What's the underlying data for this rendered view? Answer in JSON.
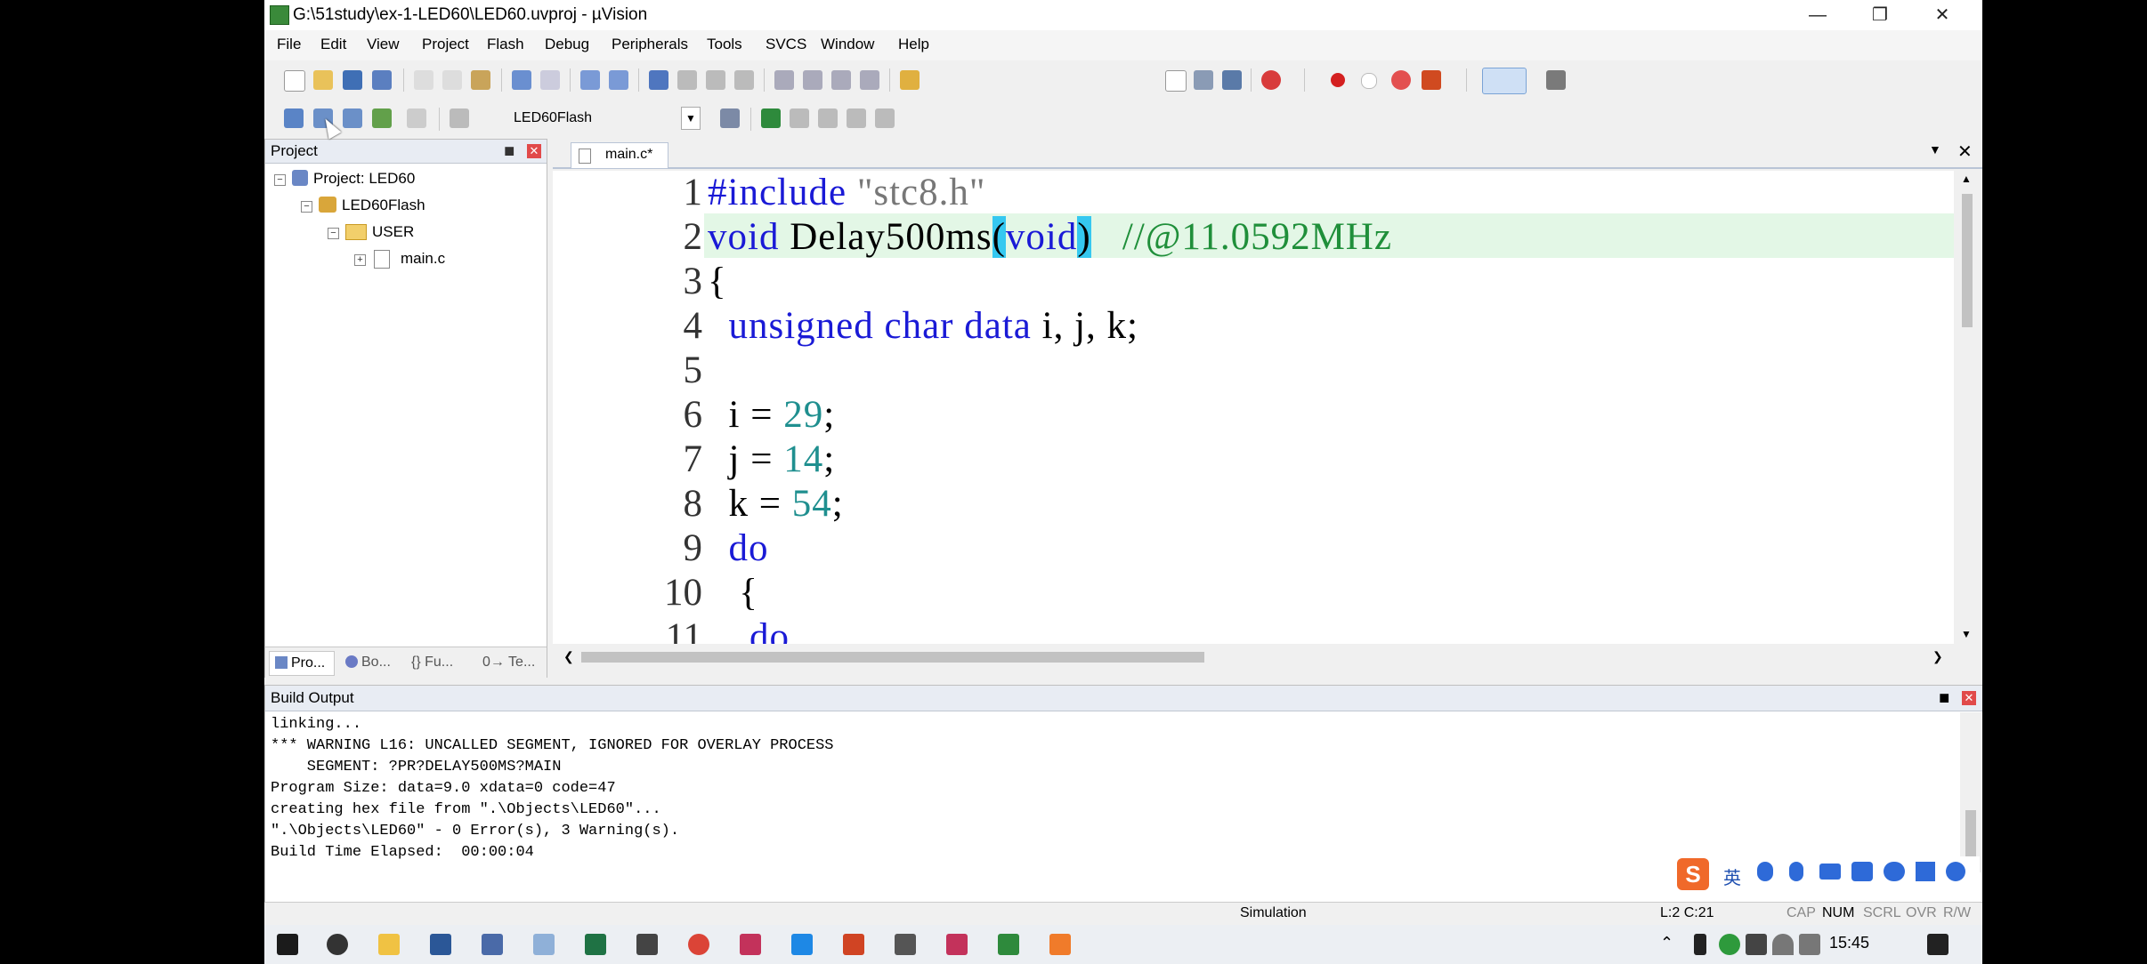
{
  "window": {
    "title": "G:\\51study\\ex-1-LED60\\LED60.uvproj - µVision"
  },
  "menu": [
    "File",
    "Edit",
    "View",
    "Project",
    "Flash",
    "Debug",
    "Peripherals",
    "Tools",
    "SVCS",
    "Window",
    "Help"
  ],
  "toolbar": {
    "target": "LED60Flash"
  },
  "project_panel": {
    "title": "Project",
    "tree": [
      {
        "label": "Project: LED60"
      },
      {
        "label": "LED60Flash"
      },
      {
        "label": "USER"
      },
      {
        "label": "main.c"
      }
    ],
    "tabs": [
      "Pro...",
      "Bo...",
      "{} Fu...",
      "0→ Te..."
    ]
  },
  "editor": {
    "tab": "main.c*",
    "lines": [
      {
        "n": "1"
      },
      {
        "n": "2"
      },
      {
        "n": "3"
      },
      {
        "n": "4"
      },
      {
        "n": "5"
      },
      {
        "n": "6"
      },
      {
        "n": "7"
      },
      {
        "n": "8"
      },
      {
        "n": "9"
      },
      {
        "n": "10"
      },
      {
        "n": "11"
      }
    ],
    "code": {
      "l1_kw": "#include",
      "l1_str": "\"stc8.h\"",
      "l2_kw1": "void",
      "l2_name": "Delay500ms",
      "l2_paren_o": "(",
      "l2_kw2": "void",
      "l2_paren_c": ")",
      "l2_cmt": "//@11.0592MHz",
      "l3": "{",
      "l4_kw": "unsigned char data",
      "l4_rest": "i, j, k;",
      "l6_var": "i = ",
      "l6_num": "29",
      "l6_end": ";",
      "l7_var": "j = ",
      "l7_num": "14",
      "l7_end": ";",
      "l8_var": "k = ",
      "l8_num": "54",
      "l8_end": ";",
      "l9_kw": "do",
      "l10": "{",
      "l11_kw": "do"
    }
  },
  "build_output": {
    "title": "Build Output",
    "lines": [
      "linking...",
      "*** WARNING L16: UNCALLED SEGMENT, IGNORED FOR OVERLAY PROCESS",
      "    SEGMENT: ?PR?DELAY500MS?MAIN",
      "Program Size: data=9.0 xdata=0 code=47",
      "creating hex file from \".\\Objects\\LED60\"...",
      "\".\\Objects\\LED60\" - 0 Error(s), 3 Warning(s).",
      "Build Time Elapsed:  00:00:04"
    ]
  },
  "status_bar": {
    "mode": "Simulation",
    "position": "L:2 C:21",
    "indicators": [
      "CAP",
      "NUM",
      "SCRL",
      "OVR",
      "R/W"
    ]
  },
  "ime": {
    "lang": "英"
  },
  "taskbar": {
    "time": "15:45"
  },
  "colors": {
    "keyword": "#1a1ad6",
    "number": "#1f8f8f",
    "comment": "#1f8f3a",
    "highlight": "#e3f7e6"
  }
}
